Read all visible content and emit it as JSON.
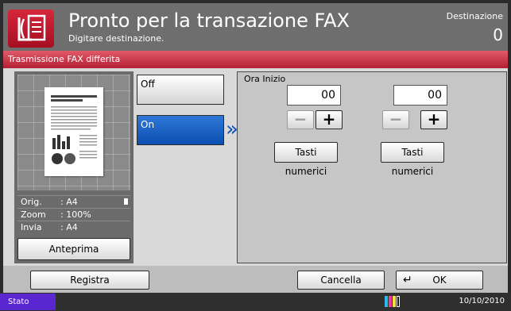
{
  "header": {
    "title": "Pronto per la transazione FAX",
    "subtitle": "Digitare destinazione.",
    "destination_label": "Destinazione",
    "destination_count": "0"
  },
  "section": {
    "title": "Trasmissione FAX differita"
  },
  "preview": {
    "info": [
      {
        "label": "Orig.",
        "value": ": A4"
      },
      {
        "label": "Zoom",
        "value": ": 100%"
      },
      {
        "label": "Invia",
        "value": ": A4"
      }
    ],
    "preview_button": "Anteprima"
  },
  "options": {
    "off_label": "Off",
    "on_label": "On",
    "selected": "On"
  },
  "time": {
    "label": "Ora Inizio",
    "hour": "00",
    "minute": "00",
    "keypad_label": "Tasti numerici"
  },
  "footer": {
    "register": "Registra",
    "cancel": "Cancella",
    "ok": "OK"
  },
  "status": {
    "stato": "Stato",
    "date": "10/10/2010"
  },
  "colors": {
    "header": "#6e6e6e",
    "section_red": "#c8283b",
    "selected_blue": "#0b5fd1",
    "status_purple": "#5a26cf"
  },
  "icons": [
    "fax-icon",
    "chevron-right-icon",
    "enter-icon",
    "toner-icon",
    "document-icon"
  ]
}
